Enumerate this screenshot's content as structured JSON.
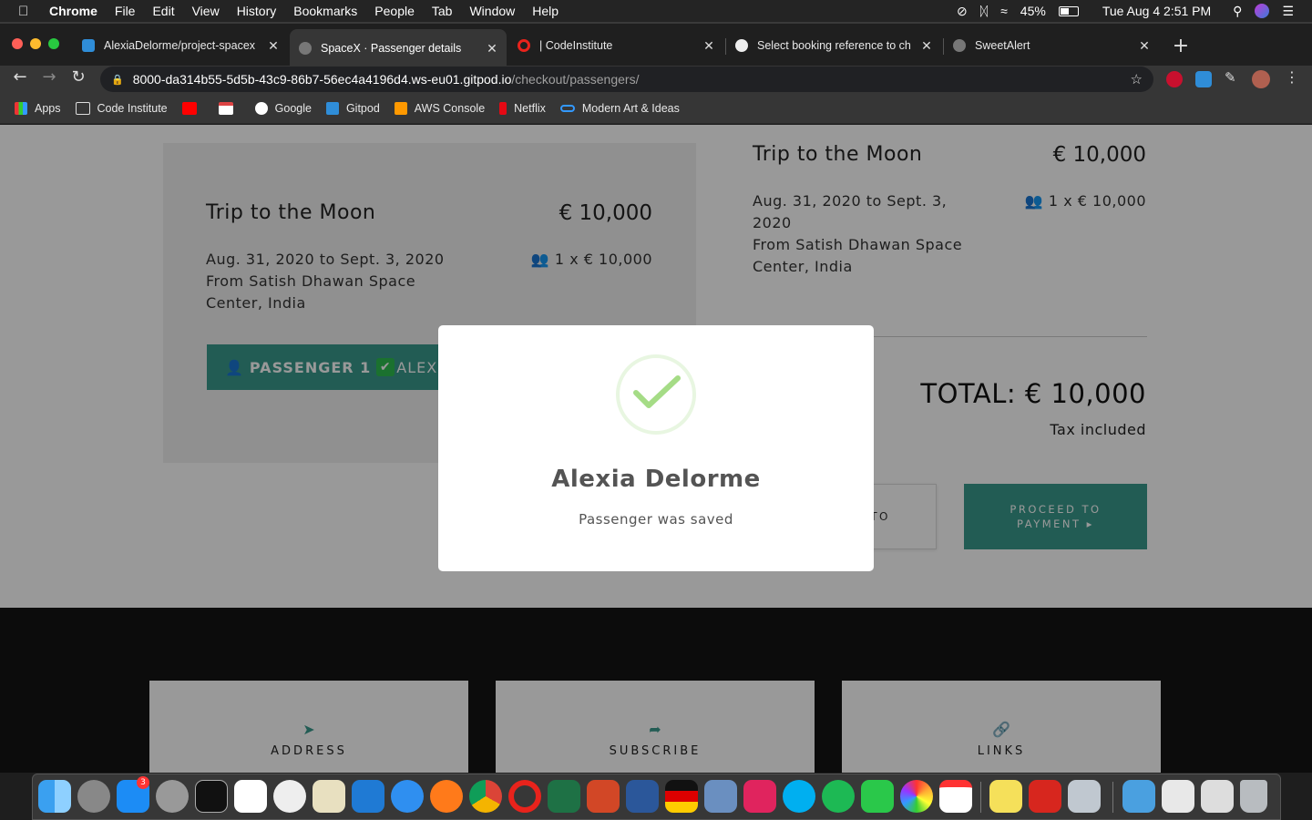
{
  "menubar": {
    "app": "Chrome",
    "menus": [
      "File",
      "Edit",
      "View",
      "History",
      "Bookmarks",
      "People",
      "Tab",
      "Window",
      "Help"
    ],
    "battery": "45%",
    "datetime": "Tue Aug 4  2:51 PM"
  },
  "tabs": [
    {
      "title": "AlexiaDelorme/project-spacex",
      "active": false
    },
    {
      "title": "SpaceX · Passenger details",
      "active": true
    },
    {
      "title": "| CodeInstitute",
      "active": false
    },
    {
      "title": "Select booking reference to ch",
      "active": false
    },
    {
      "title": "SweetAlert",
      "active": false
    }
  ],
  "omnibox": {
    "host": "8000-da314b55-5d5b-43c9-86b7-56ec4a4196d4.ws-eu01.gitpod.io",
    "path": "/checkout/passengers/"
  },
  "bookmarks": [
    "Apps",
    "Code Institute",
    "",
    "",
    "Google",
    "Gitpod",
    "AWS Console",
    "Netflix",
    "Modern Art & Ideas"
  ],
  "page": {
    "trip_title": "Trip to the Moon",
    "price": "€ 10,000",
    "left_dates": "Aug. 31, 2020 to Sept. 3, 2020",
    "left_from_1": "From Satish Dhawan Space",
    "left_from_2": "Center, India",
    "count": "1 x € 10,000",
    "passenger_button": "PASSENGER 1",
    "passenger_name": "ALEXIA",
    "right_dates_1": "Aug. 31, 2020 to Sept. 3,",
    "right_dates_2": "2020",
    "right_from_1": "From Satish Dhawan Space",
    "right_from_2": "Center, India",
    "total": "TOTAL: € 10,000",
    "tax": "Tax included",
    "back_partial": "TO",
    "pay_line1": "PROCEED TO",
    "pay_line2": "PAYMENT ▸"
  },
  "footer": {
    "cards": [
      "ADDRESS",
      "SUBSCRIBE",
      "LINKS"
    ]
  },
  "modal": {
    "title": "Alexia Delorme",
    "text": "Passenger was saved"
  },
  "dock": {
    "badge": "3"
  },
  "colors": {
    "teal": "#3a9a8d",
    "success_green": "#a5dc86"
  }
}
